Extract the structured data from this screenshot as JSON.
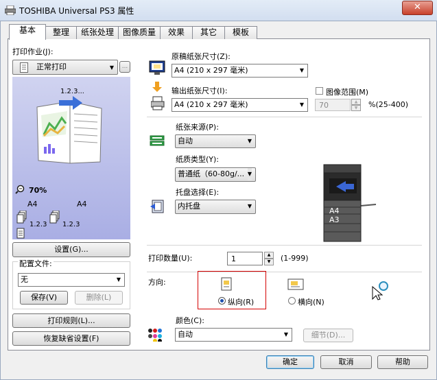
{
  "window": {
    "title": "TOSHIBA Universal PS3 属性",
    "close": "✕"
  },
  "tabs": [
    "基本",
    "整理",
    "纸张处理",
    "图像质量",
    "效果",
    "其它",
    "模板"
  ],
  "left": {
    "print_job_label": "打印作业(J):",
    "print_job_value": "正常打印",
    "zoom": "70%",
    "paper_a": "A4",
    "paper_b": "A4",
    "copies_a": "1.2.3",
    "copies_b": "1.2.3",
    "preview_order": "1.2.3...",
    "settings_button": "设置(G)...",
    "profile_label": "配置文件:",
    "profile_value": "无",
    "save_button": "保存(V)",
    "delete_button": "删除(L)",
    "rules_button": "打印规则(L)...",
    "restore_button": "恢复缺省设置(F)"
  },
  "original_size": {
    "label": "原稿纸张尺寸(Z):",
    "value": "A4 (210 x 297 毫米)"
  },
  "output_size": {
    "label": "输出纸张尺寸(I):",
    "value": "A4 (210 x 297 毫米)"
  },
  "image_scale": {
    "label": "图像范围(M)",
    "value": "70",
    "range": "%(25-400)",
    "checked": false
  },
  "paper_source": {
    "label": "纸张来源(P):",
    "value": "自动"
  },
  "paper_type": {
    "label": "纸质类型(Y):",
    "value": "普通纸（60-80g/..."
  },
  "tray": {
    "label": "托盘选择(E):",
    "value": "内托盘"
  },
  "printer_trays": [
    "A4",
    "A3"
  ],
  "copies": {
    "label": "打印数量(U):",
    "value": "1",
    "range": "(1-999)"
  },
  "orientation": {
    "label": "方向:",
    "portrait": "纵向(R)",
    "landscape": "横向(N)",
    "selected": "portrait"
  },
  "color": {
    "label": "颜色(C):",
    "value": "自动",
    "detail_button": "细节(D)..."
  },
  "footer": {
    "ok": "确定",
    "cancel": "取消",
    "help": "帮助"
  }
}
